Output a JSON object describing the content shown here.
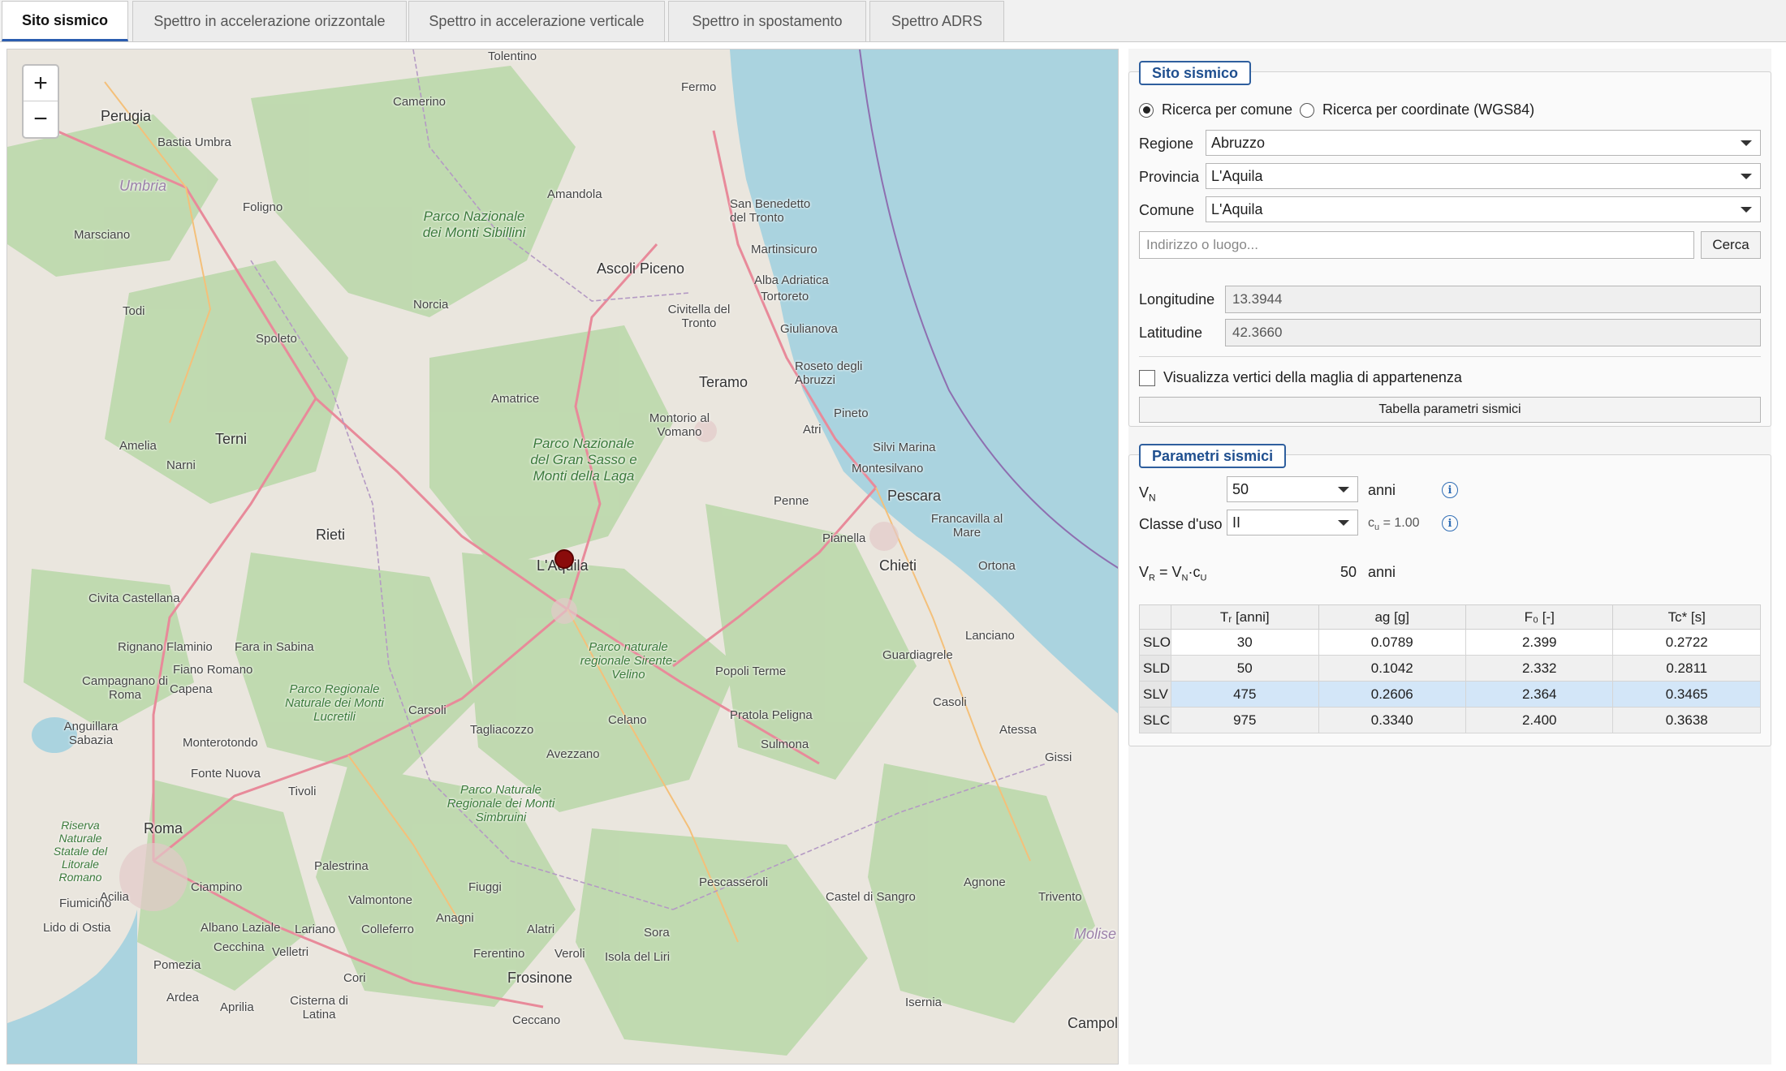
{
  "tabs": [
    "Sito sismico",
    "Spettro in accelerazione orizzontale",
    "Spettro in accelerazione verticale",
    "Spettro in spostamento",
    "Spettro ADRS"
  ],
  "map": {
    "zoom_in": "+",
    "zoom_out": "−",
    "places": [
      "Perugia",
      "Tolentino",
      "Fermo",
      "Camerino",
      "Bastia Umbra",
      "Umbria",
      "Foligno",
      "Amandola",
      "Marsciano",
      "Parco Nazionale dei Monti Sibillini",
      "San Benedetto del Tronto",
      "Ascoli Piceno",
      "Martinsicuro",
      "Alba Adriatica",
      "Tortoreto",
      "Todi",
      "Norcia",
      "Civitella del Tronto",
      "Giulianova",
      "Spoleto",
      "Roseto degli Abruzzi",
      "Teramo",
      "Amatrice",
      "Pineto",
      "Amelia",
      "Terni",
      "Montorio al Vomano",
      "Atri",
      "Silvi Marina",
      "Narni",
      "Parco Nazionale del Gran Sasso e Monti della Laga",
      "Montesilvano",
      "Pescara",
      "Penne",
      "Francavilla al Mare",
      "Rieti",
      "L'Aquila",
      "Pianella",
      "Chieti",
      "Ortona",
      "Civita Castellana",
      "Lanciano",
      "Rignano Flaminio",
      "Fara in Sabina",
      "Parco naturale regionale Sirente-Velino",
      "Guardiagrele",
      "Fiano Romano",
      "Popoli Terme",
      "Campagnano di Roma",
      "Capena",
      "Parco Regionale Naturale dei Monti Lucretili",
      "Carsoli",
      "Celano",
      "Pratola Peligna",
      "Casoli",
      "Anguillara Sabazia",
      "Tagliacozzo",
      "Atessa",
      "Sulmona",
      "Monterotondo",
      "Avezzano",
      "Gissi",
      "Fonte Nuova",
      "Tivoli",
      "Parco Naturale Regionale dei Monti Simbruini",
      "Roma",
      "Riserva Naturale Statale del Litorale Romano",
      "Palestrina",
      "Ciampino",
      "Fiuggi",
      "Pescasseroli",
      "Agnone",
      "Castel di Sangro",
      "Trivento",
      "Fiumicino",
      "Acilia",
      "Valmontone",
      "Molise",
      "Albano Laziale",
      "Anagni",
      "Lido di Ostia",
      "Lariano",
      "Colleferro",
      "Alatri",
      "Sora",
      "Cecchina",
      "Velletri",
      "Ferentino",
      "Veroli",
      "Isola del Liri",
      "Pomezia",
      "Frosinone",
      "Cori",
      "Ardea",
      "Aprilia",
      "Cisterna di Latina",
      "Isernia",
      "Ceccano",
      "Campol"
    ]
  },
  "sito": {
    "title": "Sito sismico",
    "radio_comune": "Ricerca per comune",
    "radio_coord": "Ricerca per coordinate (WGS84)",
    "regione_label": "Regione",
    "regione_value": "Abruzzo",
    "provincia_label": "Provincia",
    "provincia_value": "L'Aquila",
    "comune_label": "Comune",
    "comune_value": "L'Aquila",
    "search_placeholder": "Indirizzo o luogo...",
    "search_button": "Cerca",
    "longitudine_label": "Longitudine",
    "longitudine_value": "13.3944",
    "latitudine_label": "Latitudine",
    "latitudine_value": "42.3660",
    "checkbox_label": "Visualizza vertici della maglia di appartenenza",
    "table_button": "Tabella parametri sismici"
  },
  "parametri": {
    "title": "Parametri sismici",
    "vn_label": "V",
    "vn_sub": "N",
    "vn_value": "50",
    "vn_unit": "anni",
    "classe_label": "Classe d'uso",
    "classe_value": "II",
    "cu_text": "c",
    "cu_sub": "u",
    "cu_value": " = 1.00",
    "vr_formula": "V",
    "vr_sub1": "R",
    "vr_eq": " = V",
    "vr_sub2": "N",
    "vr_dot": "·c",
    "vr_sub3": "U",
    "vr_value": "50",
    "vr_unit": "anni",
    "info_icon": "i",
    "columns": [
      "Tᵣ [anni]",
      "ag [g]",
      "F₀ [-]",
      "Tc* [s]"
    ],
    "rows": [
      {
        "name": "SLO",
        "tr": "30",
        "ag": "0.0789",
        "f0": "2.399",
        "tc": "0.2722"
      },
      {
        "name": "SLD",
        "tr": "50",
        "ag": "0.1042",
        "f0": "2.332",
        "tc": "0.2811"
      },
      {
        "name": "SLV",
        "tr": "475",
        "ag": "0.2606",
        "f0": "2.364",
        "tc": "0.3465"
      },
      {
        "name": "SLC",
        "tr": "975",
        "ag": "0.3340",
        "f0": "2.400",
        "tc": "0.3638"
      }
    ]
  },
  "colors": {
    "accent": "#2f5f9e",
    "sea": "#aad3df",
    "land": "#e9e5dc",
    "forest": "#add19e",
    "marker": "#8a0b0b",
    "selected_row": "#d3e6f8"
  }
}
